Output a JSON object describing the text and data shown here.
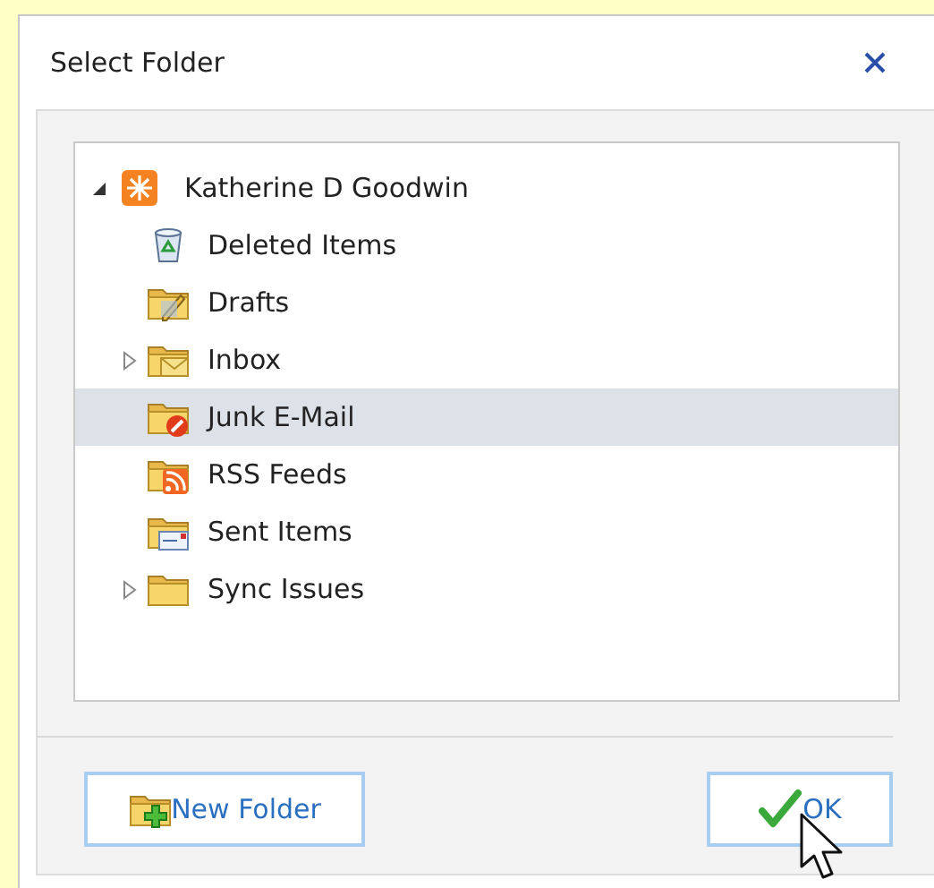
{
  "window": {
    "title": "Select Folder"
  },
  "tree": {
    "label": "Katherine D Goodwin",
    "expanded": true,
    "kind": "mailbox",
    "children": [
      {
        "label": "Deleted Items",
        "kind": "trash",
        "has_subfolders": false,
        "selected": false
      },
      {
        "label": "Drafts",
        "kind": "drafts",
        "has_subfolders": false,
        "selected": false
      },
      {
        "label": "Inbox",
        "kind": "inbox",
        "has_subfolders": true,
        "selected": false
      },
      {
        "label": "Junk E-Mail",
        "kind": "junk",
        "has_subfolders": false,
        "selected": true
      },
      {
        "label": "RSS Feeds",
        "kind": "rss",
        "has_subfolders": false,
        "selected": false
      },
      {
        "label": "Sent Items",
        "kind": "sent",
        "has_subfolders": false,
        "selected": false
      },
      {
        "label": "Sync Issues",
        "kind": "folder",
        "has_subfolders": true,
        "selected": false
      }
    ]
  },
  "buttons": [
    {
      "label": "New Folder",
      "kind": "new_folder"
    },
    {
      "label": "OK",
      "kind": "ok"
    }
  ]
}
